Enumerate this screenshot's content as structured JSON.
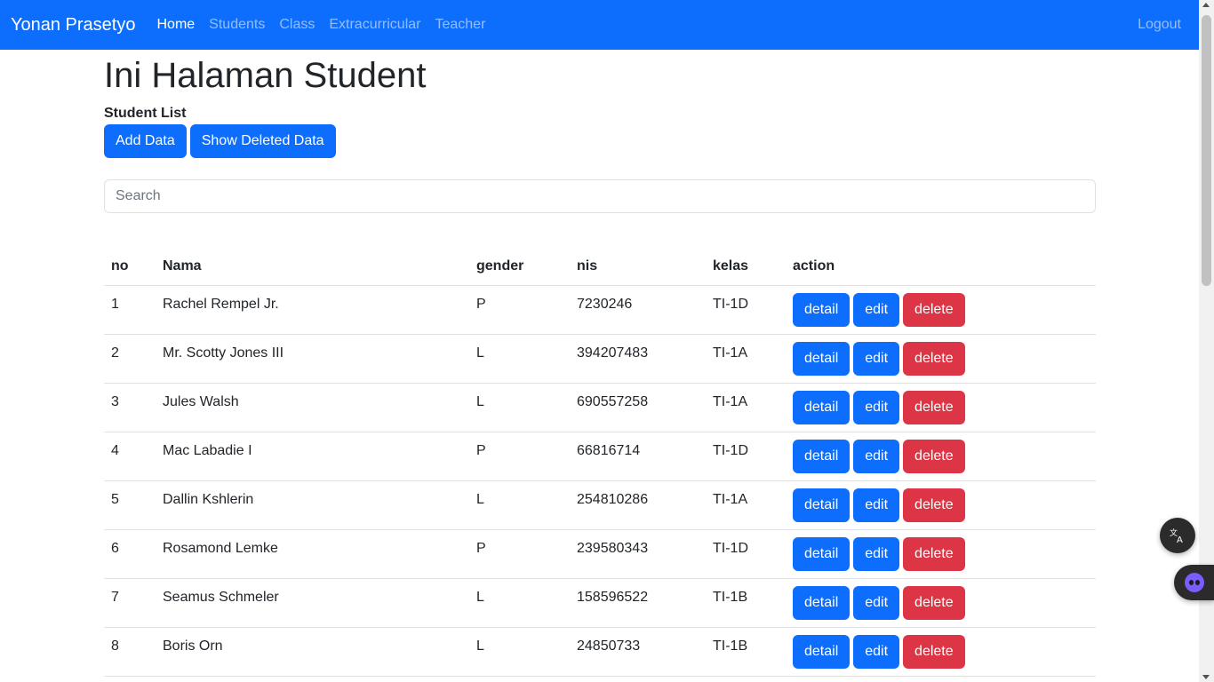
{
  "navbar": {
    "brand": "Yonan Prasetyo",
    "links": [
      "Home",
      "Students",
      "Class",
      "Extracurricular",
      "Teacher"
    ],
    "active": "Home",
    "logout": "Logout",
    "bg_color": "#0d6efd"
  },
  "page": {
    "title": "Ini Halaman Student",
    "section_label": "Student List",
    "add_button": "Add Data",
    "show_deleted_button": "Show Deleted Data",
    "search_placeholder": "Search"
  },
  "table": {
    "headers": [
      "no",
      "Nama",
      "gender",
      "nis",
      "kelas",
      "action"
    ],
    "action_labels": {
      "detail": "detail",
      "edit": "edit",
      "delete": "delete"
    },
    "rows": [
      {
        "no": "1",
        "nama": "Rachel Rempel Jr.",
        "gender": "P",
        "nis": "7230246",
        "kelas": "TI-1D"
      },
      {
        "no": "2",
        "nama": "Mr. Scotty Jones III",
        "gender": "L",
        "nis": "394207483",
        "kelas": "TI-1A"
      },
      {
        "no": "3",
        "nama": "Jules Walsh",
        "gender": "L",
        "nis": "690557258",
        "kelas": "TI-1A"
      },
      {
        "no": "4",
        "nama": "Mac Labadie I",
        "gender": "P",
        "nis": "66816714",
        "kelas": "TI-1D"
      },
      {
        "no": "5",
        "nama": "Dallin Kshlerin",
        "gender": "L",
        "nis": "254810286",
        "kelas": "TI-1A"
      },
      {
        "no": "6",
        "nama": "Rosamond Lemke",
        "gender": "P",
        "nis": "239580343",
        "kelas": "TI-1D"
      },
      {
        "no": "7",
        "nama": "Seamus Schmeler",
        "gender": "L",
        "nis": "158596522",
        "kelas": "TI-1B"
      },
      {
        "no": "8",
        "nama": "Boris Orn",
        "gender": "L",
        "nis": "24850733",
        "kelas": "TI-1B"
      }
    ]
  },
  "colors": {
    "primary": "#0d6efd",
    "danger": "#dc3545"
  },
  "floating": {
    "translate_icon": "translate-icon",
    "assistant_icon": "assistant-bot-icon"
  }
}
